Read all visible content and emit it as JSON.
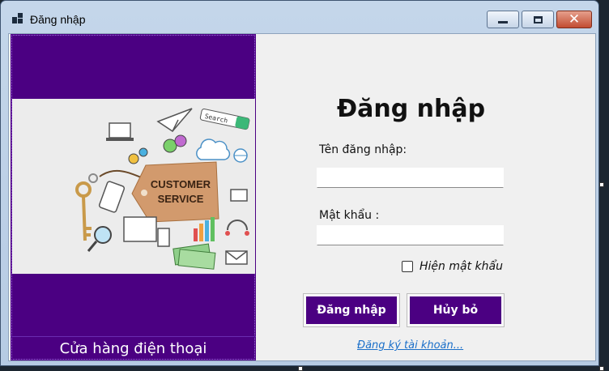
{
  "window": {
    "title": "Đăng nhập",
    "icons": {
      "app": "app-icon",
      "minimize": "minimize-icon",
      "maximize": "maximize-icon",
      "close": "close-icon"
    }
  },
  "left_panel": {
    "image_text": "CUSTOMER SERVICE",
    "image_search_tag": "Search",
    "store_name": "Cửa hàng điện thoại"
  },
  "form": {
    "title": "Đăng nhập",
    "username_label": "Tên đăng nhập:",
    "username_value": "",
    "password_label": "Mật khẩu :",
    "password_value": "",
    "show_password_label": "Hiện mật khẩu",
    "show_password_checked": false,
    "login_button": "Đăng nhập",
    "cancel_button": "Hủy bỏ",
    "register_link": "Đăng ký tài khoản..."
  },
  "colors": {
    "accent": "#4b0082",
    "link": "#1a6fc9"
  }
}
